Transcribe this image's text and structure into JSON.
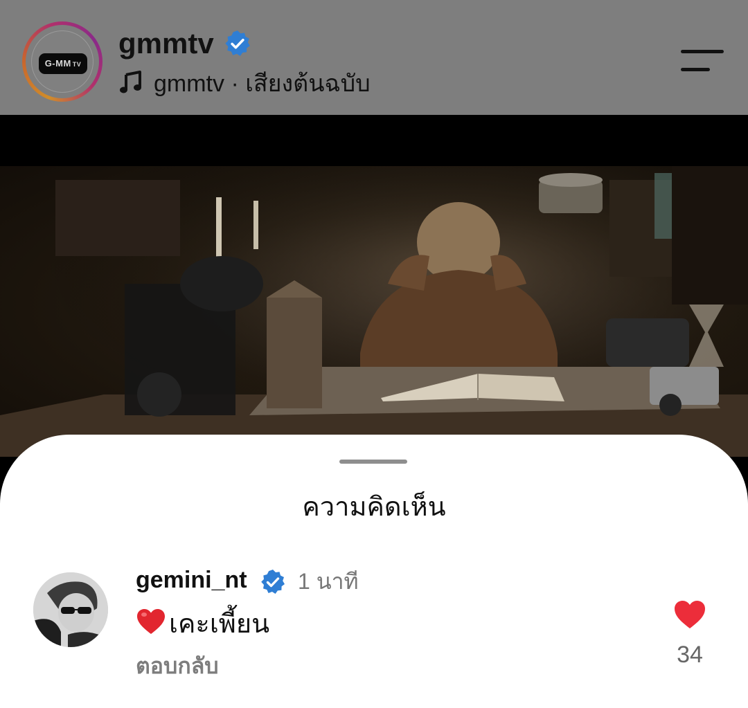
{
  "header": {
    "account_name": "gmmtv",
    "audio_text": "gmmtv · เสียงต้นฉบับ",
    "logo_text": "G-MM",
    "logo_sub_text": "TV"
  },
  "video": {
    "description": ""
  },
  "comments_sheet": {
    "title": "ความคิดเห็น",
    "comments": [
      {
        "username": "gemini_nt",
        "verified": true,
        "time": "1 นาที",
        "text": "เคะเพี้ยน",
        "reply_label": "ตอบกลับ",
        "like_count": "34",
        "liked": true
      }
    ]
  },
  "colors": {
    "header_bg": "#7e7e7e",
    "verified_blue": "#2f7ed4",
    "like_red": "#ec2d3a",
    "muted_text": "#7d7d7d"
  },
  "icons": [
    "verified-badge",
    "music-note",
    "menu",
    "heart-emoji",
    "heart-like"
  ]
}
